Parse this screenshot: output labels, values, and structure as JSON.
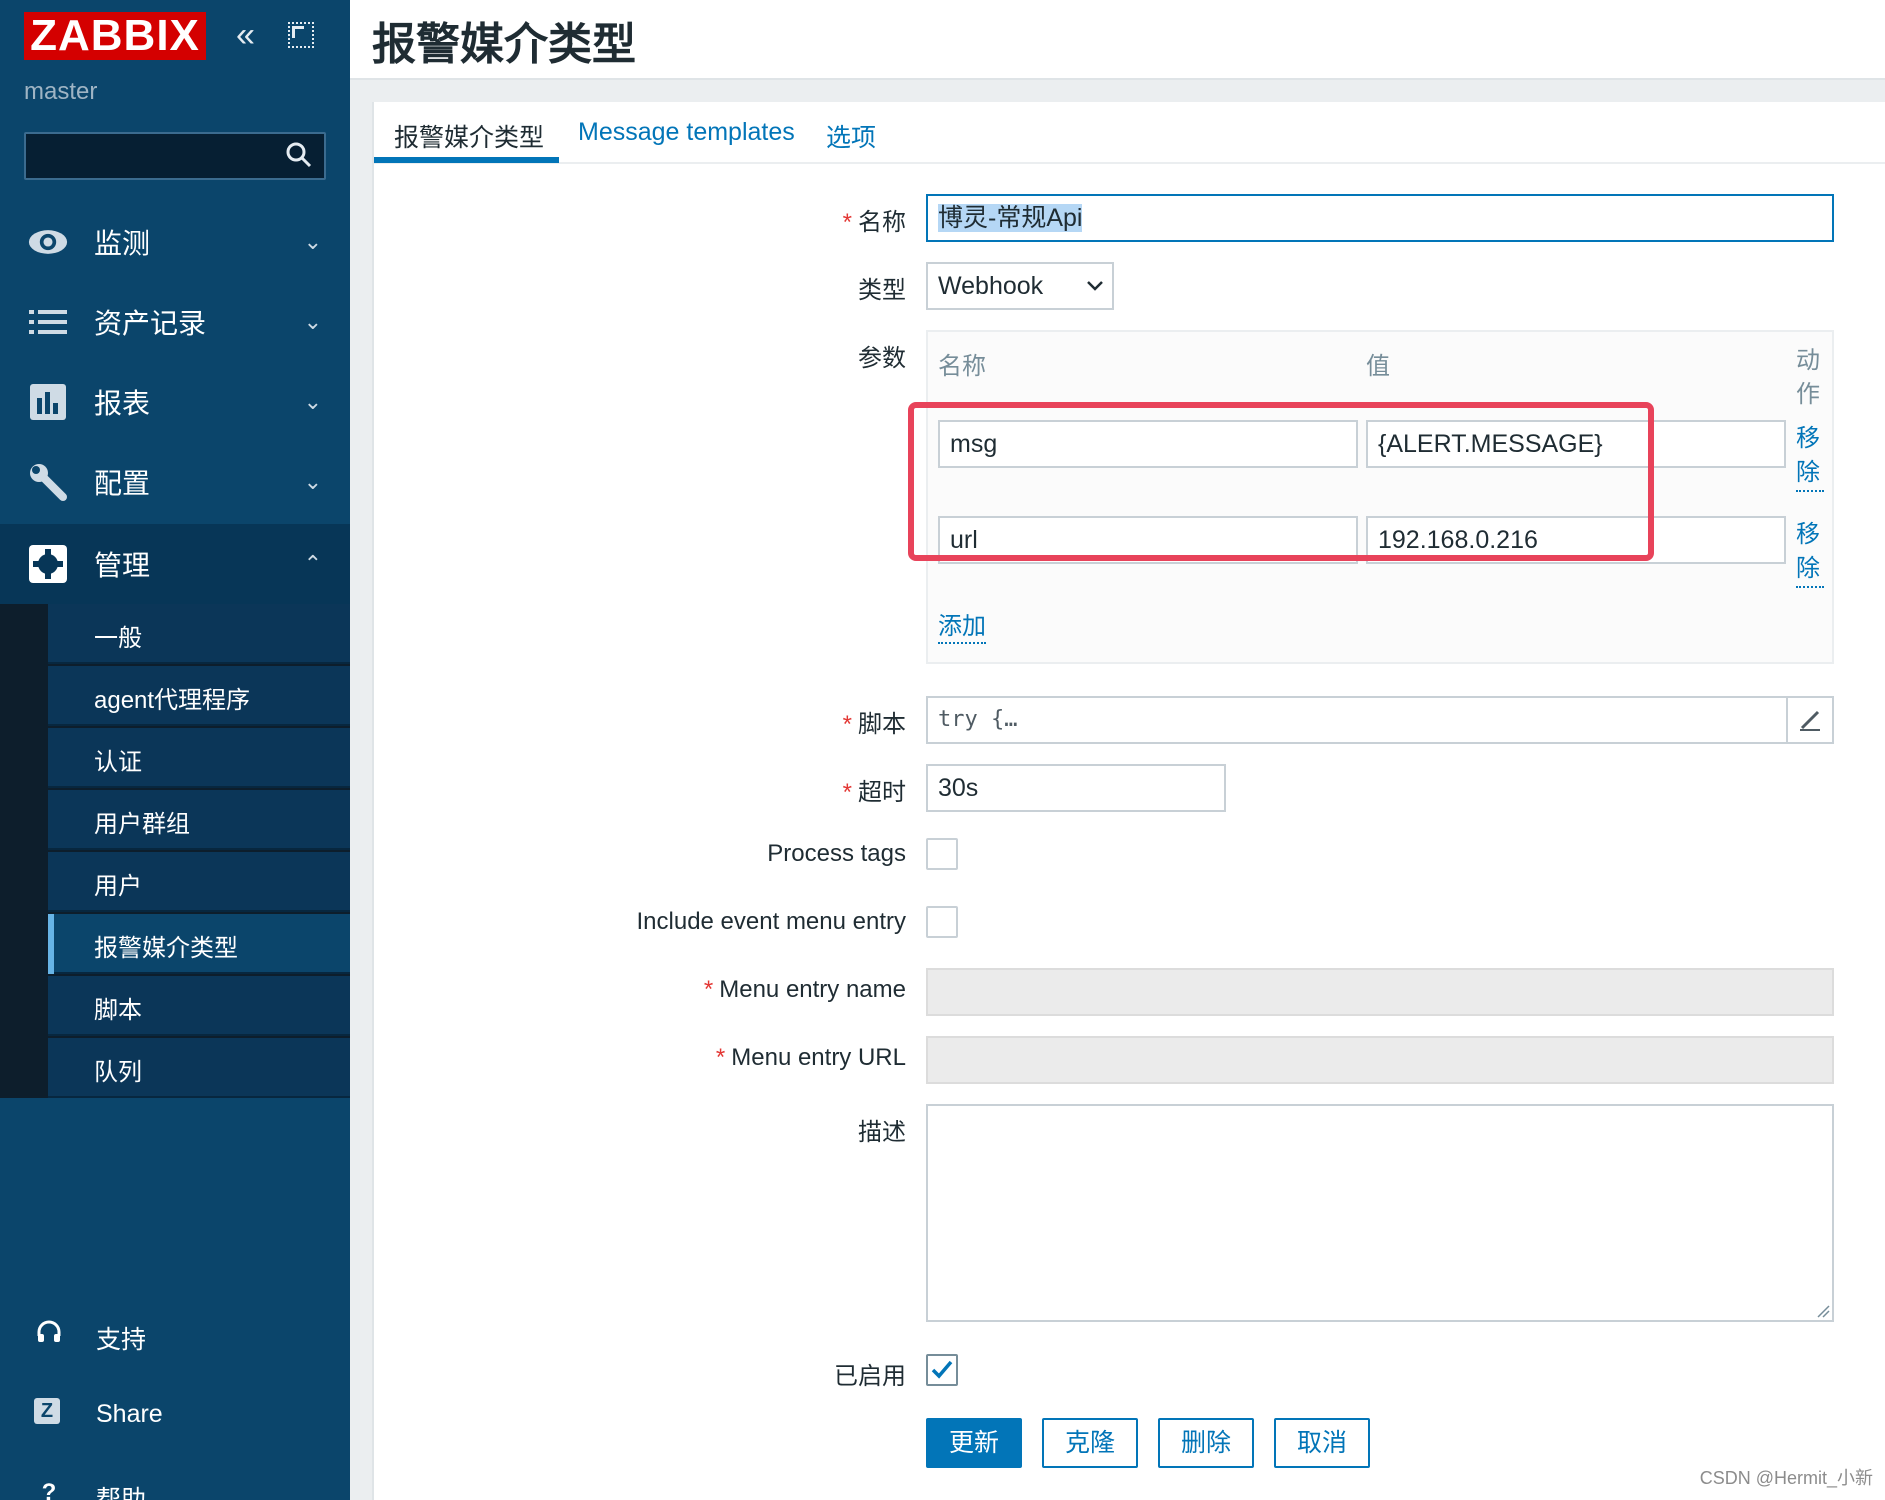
{
  "sidebar": {
    "logo": "ZABBIX",
    "server": "master",
    "search": {
      "placeholder": "",
      "value": ""
    },
    "menu": [
      {
        "label": "监测",
        "icon": "eye-icon"
      },
      {
        "label": "资产记录",
        "icon": "list-icon"
      },
      {
        "label": "报表",
        "icon": "bar-chart-icon"
      },
      {
        "label": "配置",
        "icon": "wrench-icon"
      },
      {
        "label": "管理",
        "icon": "gear-icon"
      }
    ],
    "submenu": [
      "一般",
      "agent代理程序",
      "认证",
      "用户群组",
      "用户",
      "报警媒介类型",
      "脚本",
      "队列"
    ],
    "bottom": [
      {
        "label": "支持",
        "icon": "headset-icon"
      },
      {
        "label": "Share",
        "icon": "share-icon"
      },
      {
        "label": "帮助",
        "icon": "help-icon"
      }
    ]
  },
  "header": {
    "title": "报警媒介类型"
  },
  "tabs": [
    "报警媒介类型",
    "Message templates",
    "选项"
  ],
  "form": {
    "name_label": "名称",
    "name_value": "博灵-常规Api",
    "type_label": "类型",
    "type_value": "Webhook",
    "params_label": "参数",
    "params_head_name": "名称",
    "params_head_value": "值",
    "params_head_action": "动作",
    "params": [
      {
        "name": "msg",
        "value": "{ALERT.MESSAGE}",
        "action": "移除"
      },
      {
        "name": "url",
        "value": "192.168.0.216",
        "action": "移除"
      }
    ],
    "add_link": "添加",
    "script_label": "脚本",
    "script_value": "try {…",
    "timeout_label": "超时",
    "timeout_value": "30s",
    "process_tags_label": "Process tags",
    "event_menu_label": "Include event menu entry",
    "menu_name_label": "Menu entry name",
    "menu_url_label": "Menu entry URL",
    "desc_label": "描述",
    "enabled_label": "已启用",
    "enabled": true
  },
  "buttons": {
    "update": "更新",
    "clone": "克隆",
    "delete": "删除",
    "cancel": "取消"
  },
  "watermark": "CSDN @Hermit_小新",
  "colors": {
    "sidebar": "#0b456b",
    "brand": "#d40000",
    "accent": "#0275b8",
    "highlight": "#e8435a"
  }
}
